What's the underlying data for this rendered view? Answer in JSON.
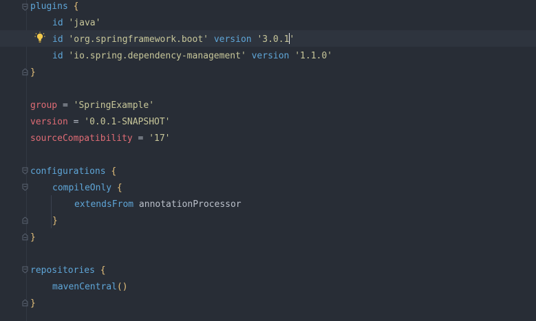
{
  "editor": {
    "lines": {
      "l1": {
        "name": "plugins",
        "brace": "{"
      },
      "l2": {
        "kw": "id",
        "str": "'java'"
      },
      "l3": {
        "kw": "id",
        "str": "'org.springframework.boot'",
        "kw2": "version",
        "str2_before": "'3.0.1",
        "str2_after": "'"
      },
      "l4": {
        "kw": "id",
        "str": "'io.spring.dependency-management'",
        "kw2": "version",
        "str2": "'1.1.0'"
      },
      "l5": {
        "brace": "}"
      },
      "l7": {
        "prop": "group",
        "eq": " = ",
        "str": "'SpringExample'"
      },
      "l8": {
        "prop": "version",
        "eq": " = ",
        "str": "'0.0.1-SNAPSHOT'"
      },
      "l9": {
        "prop": "sourceCompatibility",
        "eq": " = ",
        "str": "'17'"
      },
      "l11": {
        "name": "configurations",
        "brace": "{"
      },
      "l12": {
        "name": "compileOnly",
        "brace": "{"
      },
      "l13": {
        "kw": "extendsFrom",
        "plain": "annotationProcessor"
      },
      "l14": {
        "brace": "}"
      },
      "l15": {
        "brace": "}"
      },
      "l17": {
        "name": "repositories",
        "brace": "{"
      },
      "l18": {
        "name": "mavenCentral",
        "paren": "()"
      },
      "l19": {
        "brace": "}"
      }
    },
    "colors": {
      "background": "#282d36",
      "keyword": "#5fa6d8",
      "string": "#c8c79a",
      "property": "#e06c75",
      "brace": "#e5c07b",
      "text": "#bbc1cb"
    },
    "icons": {
      "intention": "lightbulb-icon",
      "fold": "fold-marker-icon"
    }
  }
}
